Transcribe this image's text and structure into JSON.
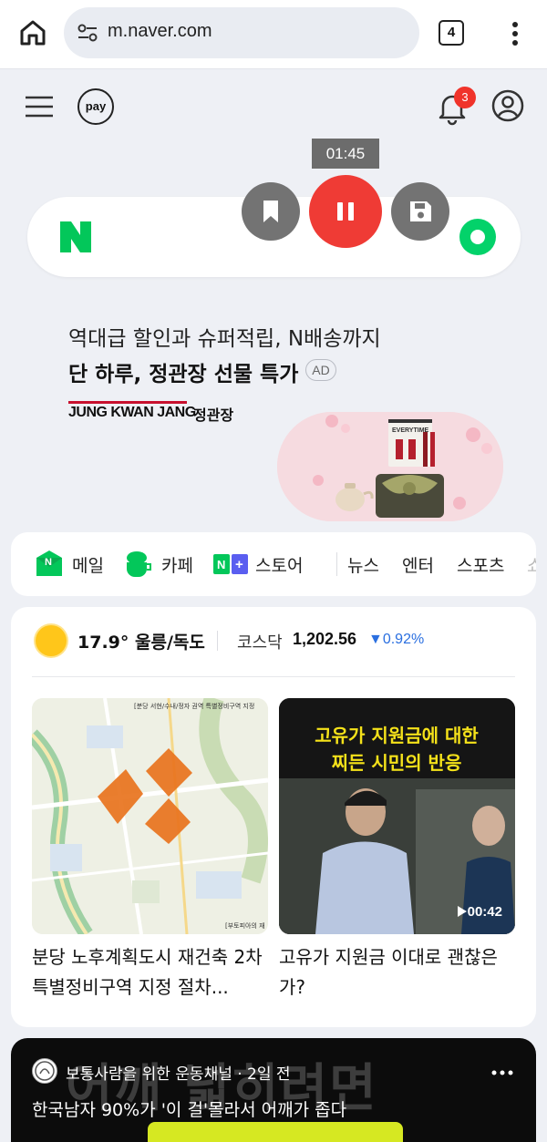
{
  "browser": {
    "url": "m.naver.com",
    "tab_count": "4"
  },
  "header": {
    "pay_label": "pay",
    "notification_count": "3"
  },
  "recorder": {
    "timer": "01:45"
  },
  "ad": {
    "line1": "역대급 할인과 슈퍼적립, N배송까지",
    "line2": "단 하루, 정관장 선물 특가",
    "tag": "AD",
    "brand_en": "JUNG KWAN JANG",
    "brand_ko": "정관장",
    "product_label": "EVERYTIME"
  },
  "shortcuts": {
    "mail": "메일",
    "cafe": "카페",
    "store": "스토어",
    "news": "뉴스",
    "entertainment": "엔터",
    "sports": "스포츠",
    "more": "쇼"
  },
  "info": {
    "weather": "17.9° 울릉/독도",
    "kosdaq_label": "코스닥",
    "kosdaq_value": "1,202.56",
    "kosdaq_change": "▼0.92%"
  },
  "news": [
    {
      "title": "분당 노후계획도시 재건축 2차 특별정비구역 지정 절차...",
      "caption": "[분당 서현/수내/정자 권역 특별정비구역 지정",
      "footer": "[부토피아의 재"
    },
    {
      "title": "고유가 지원금 이대로 괜찮은가?",
      "banner_line1": "고유가 지원금에 대한",
      "banner_line2": "찌든 시민의 반응",
      "duration": "00:42"
    }
  ],
  "video_card": {
    "channel": "보통사람을 위한 운동채널 · 2일 전",
    "title": "한국남자 90%가 '이 걸'몰라서 어깨가 좁다",
    "bg_text": "어깨 넓히려면"
  },
  "colors": {
    "naver_green": "#03c75a",
    "record_red": "#ef3b35",
    "badge_red": "#f0332a",
    "down_blue": "#2a6fe0",
    "page_bg": "#eef0f5"
  }
}
